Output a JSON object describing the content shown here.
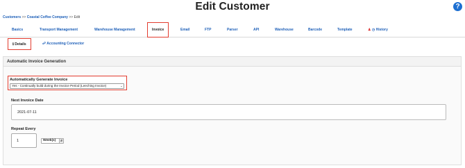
{
  "header": {
    "title": "Edit Customer",
    "help_icon": "?"
  },
  "breadcrumb": {
    "items": [
      "Customers",
      "Coastal Coffee Company"
    ],
    "separator": ">>",
    "current": "Edit"
  },
  "tabs": [
    {
      "label": "Basics"
    },
    {
      "label": "Transport Management"
    },
    {
      "label": "Warehouse Management"
    },
    {
      "label": "Invoice",
      "active": true
    },
    {
      "label": "Email"
    },
    {
      "label": "FTP"
    },
    {
      "label": "Parser"
    },
    {
      "label": "API"
    },
    {
      "label": "Warehouse"
    },
    {
      "label": "Barcode"
    },
    {
      "label": "Template"
    },
    {
      "label": "History",
      "icons": [
        "user-icon",
        "clock-icon"
      ]
    }
  ],
  "subtabs": [
    {
      "label": "Details",
      "icon": "info-icon",
      "active": true
    },
    {
      "label": "Accounting Connector",
      "icon": "link-icon"
    }
  ],
  "panel": {
    "title": "Automatic Invoice Generation",
    "auto_generate": {
      "label": "Automatically Generate Invoice",
      "value": "Yes - Continually build during the Invoice Period (Leeching Invoice)"
    },
    "next_invoice_date": {
      "label": "Next Invoice Date",
      "value": "2021-07-11"
    },
    "repeat_every": {
      "label": "Repeat Every",
      "number": "1",
      "unit": "Week(s)"
    }
  },
  "colors": {
    "link": "#1d5fb8",
    "highlight": "#e23b2e",
    "help": "#1d6fd1"
  }
}
